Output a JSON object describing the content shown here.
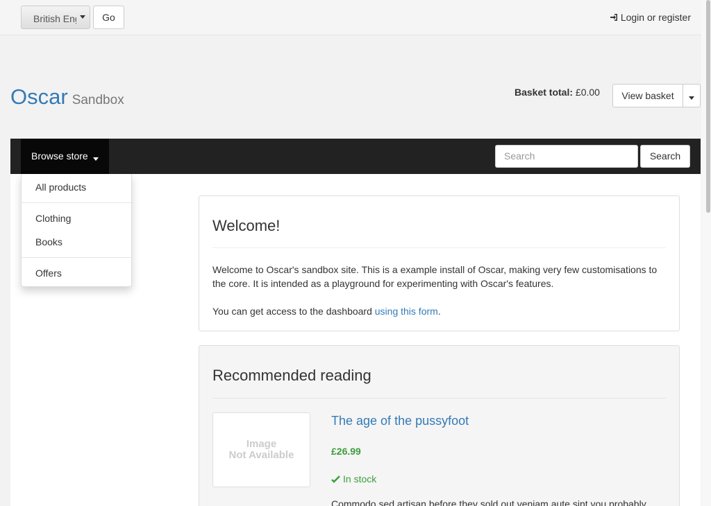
{
  "topbar": {
    "language_value": "British English",
    "go_label": "Go",
    "login_label": "Login or register"
  },
  "header": {
    "brand": "Oscar",
    "tagline": "Sandbox",
    "basket_total_label": "Basket total:",
    "basket_total_value": "£0.00",
    "view_basket_label": "View basket"
  },
  "navbar": {
    "browse_label": "Browse store",
    "search_placeholder": "Search",
    "search_button": "Search"
  },
  "browse_menu": {
    "items": [
      "All products",
      "Clothing",
      "Books",
      "Offers"
    ]
  },
  "welcome": {
    "title": "Welcome!",
    "paragraph1": "Welcome to Oscar's sandbox site.  This is a example install of Oscar, making very few customisations to the core.  It is intended as a playground for experimenting with Oscar's features.",
    "paragraph2_prefix": "You can get access to the dashboard ",
    "paragraph2_link": "using this form",
    "paragraph2_suffix": "."
  },
  "recommended": {
    "title": "Recommended reading",
    "product": {
      "image_text_line1": "Image",
      "image_text_line2": "Not Available",
      "title": "The age of the pussyfoot",
      "price": "£26.99",
      "stock": "In stock",
      "description": "Commodo sed artisan before they sold out veniam aute sint you probably"
    }
  },
  "colors": {
    "link": "#337ab7",
    "navbar_bg": "#222222",
    "in_stock": "#3c9d3c"
  }
}
